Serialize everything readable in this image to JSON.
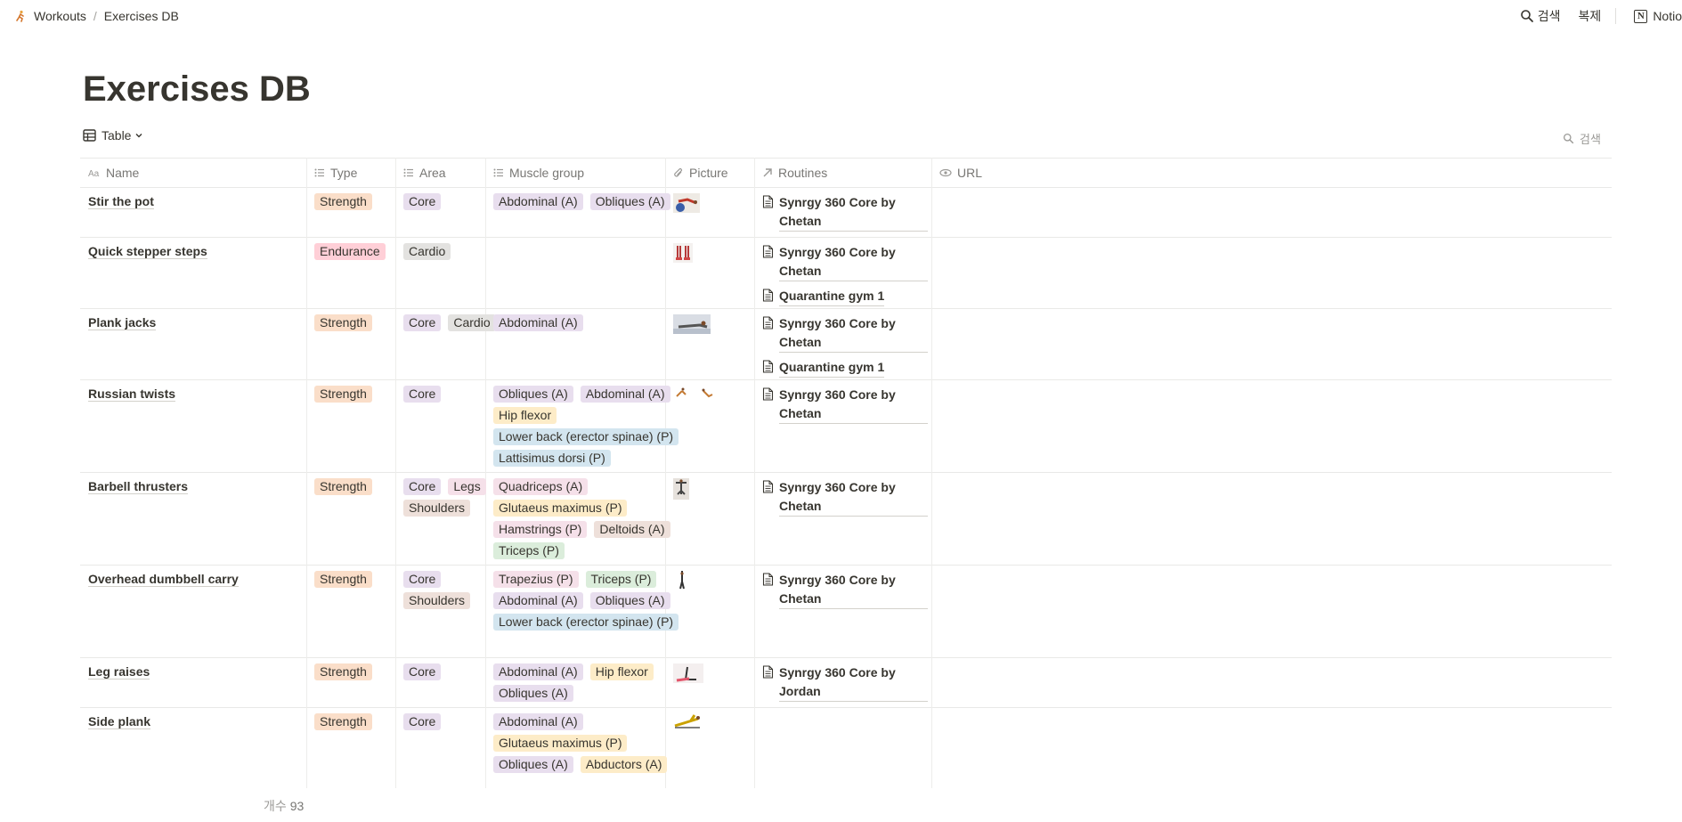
{
  "breadcrumb": {
    "items": [
      "Workouts",
      "Exercises DB"
    ],
    "icon": "runner-icon"
  },
  "topbar": {
    "search": "검색",
    "duplicate": "복제",
    "app": "Notio"
  },
  "page": {
    "title": "Exercises DB"
  },
  "view": {
    "label": "Table",
    "search_placeholder": "검색"
  },
  "table": {
    "columns": [
      {
        "label": "Name",
        "icon": "text-icon"
      },
      {
        "label": "Type",
        "icon": "list-icon"
      },
      {
        "label": "Area",
        "icon": "list-icon"
      },
      {
        "label": "Muscle group",
        "icon": "list-icon"
      },
      {
        "label": "Picture",
        "icon": "paperclip-icon"
      },
      {
        "label": "Routines",
        "icon": "arrow-up-right-icon"
      },
      {
        "label": "URL",
        "icon": "link-icon"
      }
    ],
    "rows": [
      {
        "name": "Stir the pot",
        "type": [
          "Strength"
        ],
        "area": [
          "Core"
        ],
        "muscle": [
          "Abdominal (A)",
          "Obliques (A)"
        ],
        "routines": [
          "Synrgy 360 Core by Chetan"
        ]
      },
      {
        "name": "Quick stepper steps",
        "type": [
          "Endurance"
        ],
        "area": [
          "Cardio"
        ],
        "muscle": [],
        "routines": [
          "Synrgy 360 Core by Chetan",
          "Quarantine gym 1"
        ]
      },
      {
        "name": "Plank jacks",
        "type": [
          "Strength"
        ],
        "area": [
          "Core",
          "Cardio"
        ],
        "muscle": [
          "Abdominal (A)"
        ],
        "routines": [
          "Synrgy 360 Core by Chetan",
          "Quarantine gym 1"
        ]
      },
      {
        "name": "Russian twists",
        "type": [
          "Strength"
        ],
        "area": [
          "Core"
        ],
        "muscle": [
          "Obliques (A)",
          "Abdominal (A)",
          "Hip flexor",
          "Lower back (erector spinae) (P)",
          "Lattisimus dorsi (P)"
        ],
        "routines": [
          "Synrgy 360 Core by Chetan"
        ]
      },
      {
        "name": "Barbell thrusters",
        "type": [
          "Strength"
        ],
        "area": [
          "Core",
          "Legs",
          "Shoulders"
        ],
        "muscle": [
          "Quadriceps (A)",
          "Glutaeus maximus (P)",
          "Hamstrings (P)",
          "Deltoids (A)",
          "Triceps (P)"
        ],
        "routines": [
          "Synrgy 360 Core by Chetan"
        ]
      },
      {
        "name": "Overhead dumbbell carry",
        "type": [
          "Strength"
        ],
        "area": [
          "Core",
          "Shoulders"
        ],
        "muscle": [
          "Trapezius (P)",
          "Triceps (P)",
          "Abdominal (A)",
          "Obliques (A)",
          "Lower back (erector spinae) (P)"
        ],
        "routines": [
          "Synrgy 360 Core by Chetan"
        ]
      },
      {
        "name": "Leg raises",
        "type": [
          "Strength"
        ],
        "area": [
          "Core"
        ],
        "muscle": [
          "Abdominal (A)",
          "Hip flexor",
          "Obliques (A)"
        ],
        "routines": [
          "Synrgy 360 Core by Jordan"
        ]
      },
      {
        "name": "Side plank",
        "type": [
          "Strength"
        ],
        "area": [
          "Core"
        ],
        "muscle": [
          "Abdominal (A)",
          "Glutaeus maximus (P)",
          "Obliques (A)",
          "Abductors (A)"
        ],
        "routines": []
      }
    ]
  },
  "footer": {
    "count_label": "개수",
    "count": "93"
  },
  "colors": {
    "Strength": "#fadec9",
    "Endurance": "#ffcfd7",
    "Cardio": "#e3e2e0",
    "Core": "#e8deee",
    "Legs": "#f5e0e9",
    "Shoulders": "#eee0da",
    "Abdominal (A)": "#e8deee",
    "Obliques (A)": "#e8deee",
    "Hip flexor": "#fdecc8",
    "Lower back (erector spinae) (P)": "#d3e5ef",
    "Lattisimus dorsi (P)": "#d3e5ef",
    "Quadriceps (A)": "#f5e0e9",
    "Glutaeus maximus (P)": "#fdecc8",
    "Hamstrings (P)": "#f5e0e9",
    "Deltoids (A)": "#eee0da",
    "Triceps (P)": "#dbeddb",
    "Trapezius (P)": "#f5e0e9",
    "Abductors (A)": "#fdecc8"
  }
}
